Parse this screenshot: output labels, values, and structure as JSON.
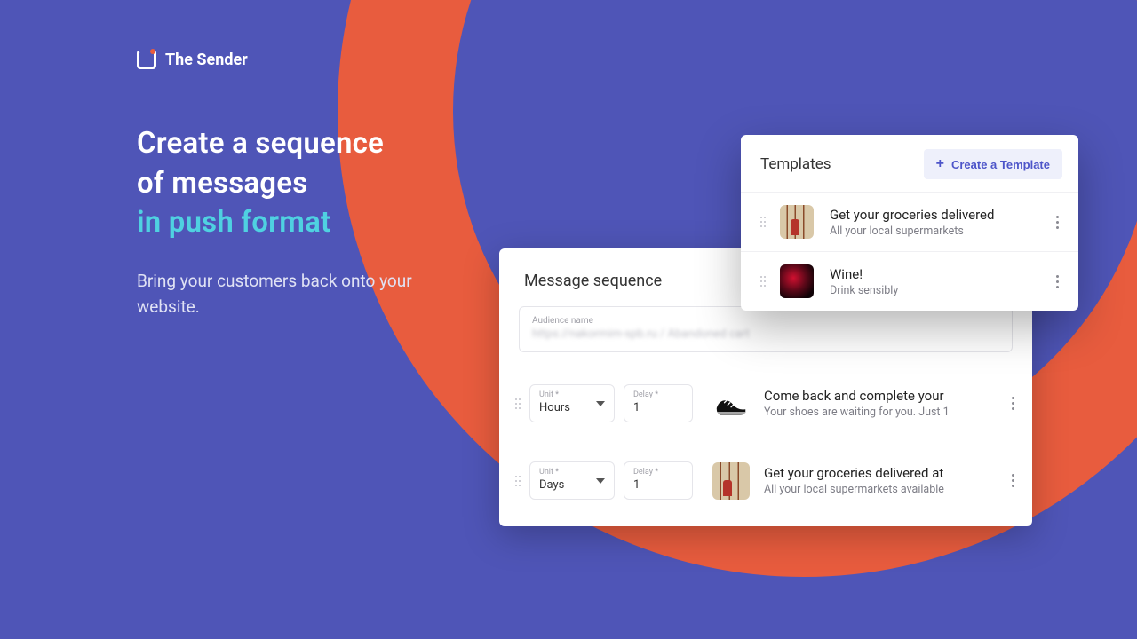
{
  "brand": {
    "name": "The Sender"
  },
  "hero": {
    "line1": "Create a sequence",
    "line2": "of messages",
    "line3": "in push format",
    "sub": "Bring your customers back onto your website."
  },
  "sequence": {
    "title": "Message sequence",
    "audience_label": "Audience name",
    "audience_value": "https://nakormim-spb.ru / Abandoned cart",
    "unit_label": "Unit *",
    "delay_label": "Delay *",
    "rows": [
      {
        "unit": "Hours",
        "delay": "1",
        "title": "Come back and complete your",
        "sub": "Your shoes are waiting for you. Just 1",
        "thumb": "shoe"
      },
      {
        "unit": "Days",
        "delay": "1",
        "title": "Get your groceries delivered at",
        "sub": "All your local supermarkets available",
        "thumb": "grocery"
      }
    ]
  },
  "templates": {
    "title": "Templates",
    "create_label": "Create a Template",
    "rows": [
      {
        "title": "Get your groceries delivered",
        "sub": "All your local supermarkets",
        "thumb": "grocery"
      },
      {
        "title": "Wine!",
        "sub": "Drink sensibly",
        "thumb": "wine"
      }
    ]
  }
}
